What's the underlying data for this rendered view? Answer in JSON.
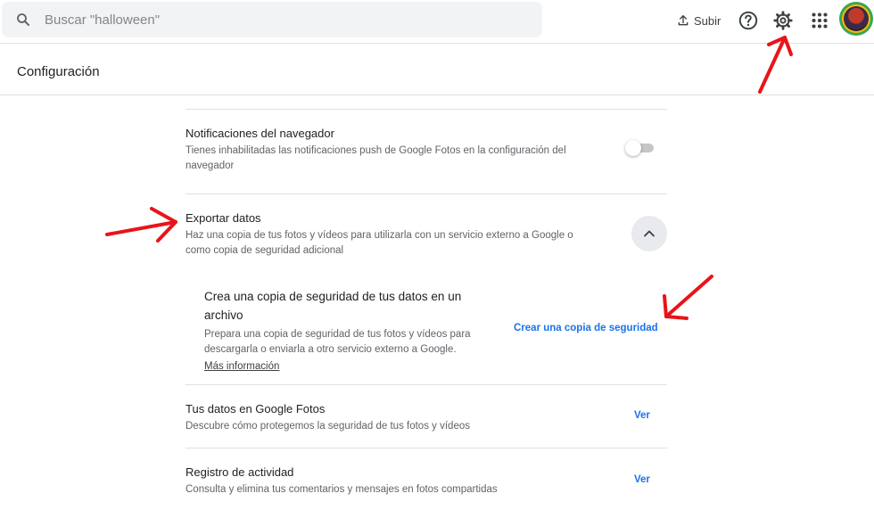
{
  "topbar": {
    "search_placeholder": "Buscar \"halloween\"",
    "upload_label": "Subir",
    "icons": [
      "search-icon",
      "upload-icon",
      "help-icon",
      "settings-icon",
      "apps-icon",
      "avatar"
    ]
  },
  "page": {
    "title": "Configuración"
  },
  "settings": {
    "notifications": {
      "title": "Notificaciones del navegador",
      "description_line1": "Tienes inhabilitadas las notificaciones push de Google Fotos en la configuración del",
      "description_line2": "navegador",
      "toggle_on": false
    },
    "export": {
      "title": "Exportar datos",
      "description_line1": "Haz una copia de tus fotos y vídeos para utilizarla con un servicio externo a Google o",
      "description_line2": "como copia de seguridad adicional",
      "expanded": true,
      "backup": {
        "title_line1": "Crea una copia de seguridad de tus datos en un",
        "title_line2": "archivo",
        "description_line1": "Prepara una copia de seguridad de tus fotos y vídeos para",
        "description_line2": "descargarla o enviarla a otro servicio externo a Google.",
        "more_info": "Más información",
        "action_label": "Crear una copia de seguridad"
      }
    },
    "your_data": {
      "title": "Tus datos en Google Fotos",
      "description": "Descubre cómo protegemos la seguridad de tus fotos y vídeos",
      "action_label": "Ver"
    },
    "activity": {
      "title": "Registro de actividad",
      "description": "Consulta y elimina tus comentarios y mensajes en fotos compartidas",
      "action_label": "Ver"
    }
  },
  "colors": {
    "accent": "#1a73e8",
    "annotation": "#e8141a",
    "divider": "#e0e0e0"
  }
}
